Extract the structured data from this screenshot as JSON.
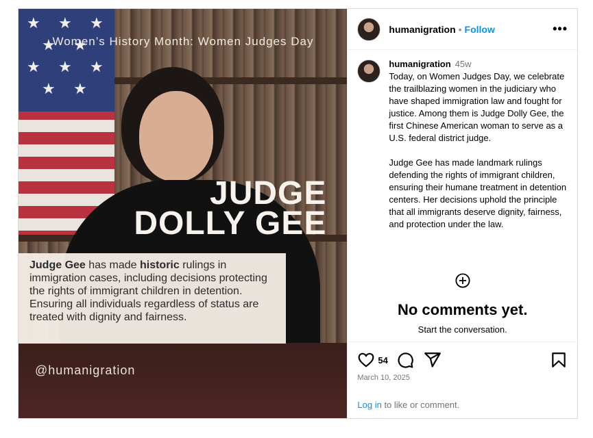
{
  "media": {
    "overlay_title": "Women’s History Month: Women Judges Day",
    "name_line1": "JUDGE",
    "name_line2": "DOLLY GEE",
    "quote": {
      "part1": "Judge Gee",
      "part2": " has made ",
      "part3": "historic",
      "part4": " rulings in immigration cases, including decisions protecting the rights of immigrant children in detention. Ensuring all individuals regardless of status are treated with dignity and fairness."
    },
    "handle": "@humanigration",
    "colors": {
      "flag_red": "#b8323f",
      "flag_blue": "#2f3f7a",
      "quote_bg": "#f5efe8"
    }
  },
  "header": {
    "username": "humanigration",
    "separator": "•",
    "follow_label": "Follow",
    "more_icon": "more-horizontal-icon"
  },
  "caption": {
    "username": "humanigration",
    "time": "45w",
    "text": "Today, on Women Judges Day, we celebrate the trailblazing women in the judiciary who have shaped immigration law and fought for justice. Among them is Judge Dolly Gee, the first Chinese American woman to serve as a U.S. federal district judge.\n\nJudge Gee has made landmark rulings defending the rights of immigrant children, ensuring their humane treatment in detention centers. Her decisions uphold the principle that all immigrants deserve dignity, fairness, and protection under the law."
  },
  "comments": {
    "title": "No comments yet.",
    "subtitle": "Start the conversation."
  },
  "actions": {
    "likes": "54",
    "date": "March 10, 2025",
    "icons": [
      "heart-icon",
      "comment-icon",
      "share-icon",
      "bookmark-icon"
    ]
  },
  "footer": {
    "login_link": "Log in",
    "login_rest": " to like or comment."
  },
  "colors": {
    "link": "#0095f6",
    "muted": "#737373",
    "border": "#dbdbdb"
  }
}
